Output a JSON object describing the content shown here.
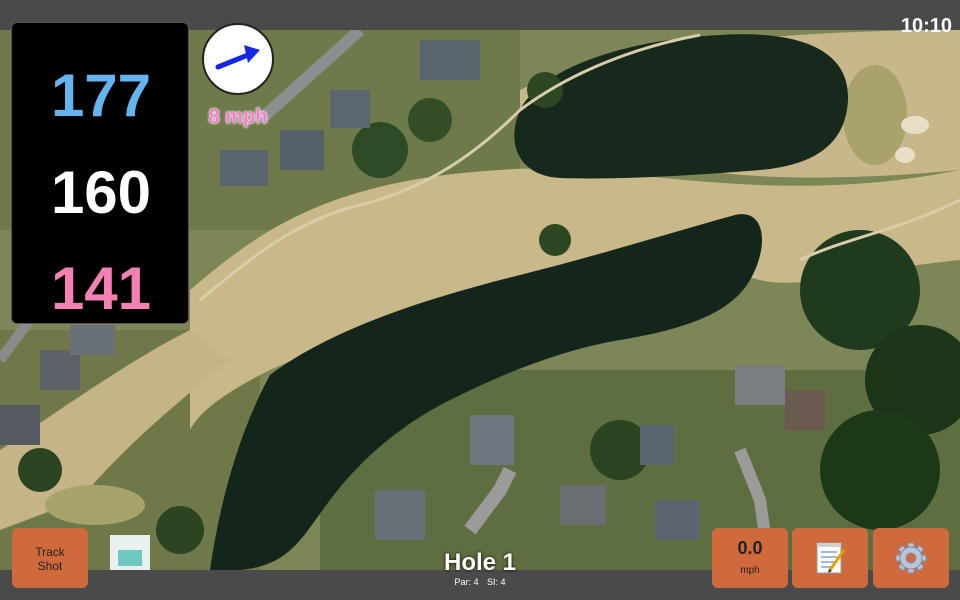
{
  "status": {
    "time": "10:10"
  },
  "distances": {
    "back": "177",
    "center": "160",
    "front": "141",
    "back_color": "#64b4f0",
    "center_color": "#ffffff",
    "front_color": "#f580b4"
  },
  "wind": {
    "speed": "8 mph",
    "icon": "arrow-icon"
  },
  "hole": {
    "title": "Hole 1",
    "par": "Par: 4",
    "si": "SI: 4"
  },
  "buttons": {
    "track_shot": "Track Shot",
    "speed_value": "0.0",
    "speed_unit": "mph",
    "notes_icon": "notepad-icon",
    "settings_icon": "gear-icon"
  },
  "colors": {
    "button": "#d06a3c",
    "bar": "#4a4a4a"
  }
}
